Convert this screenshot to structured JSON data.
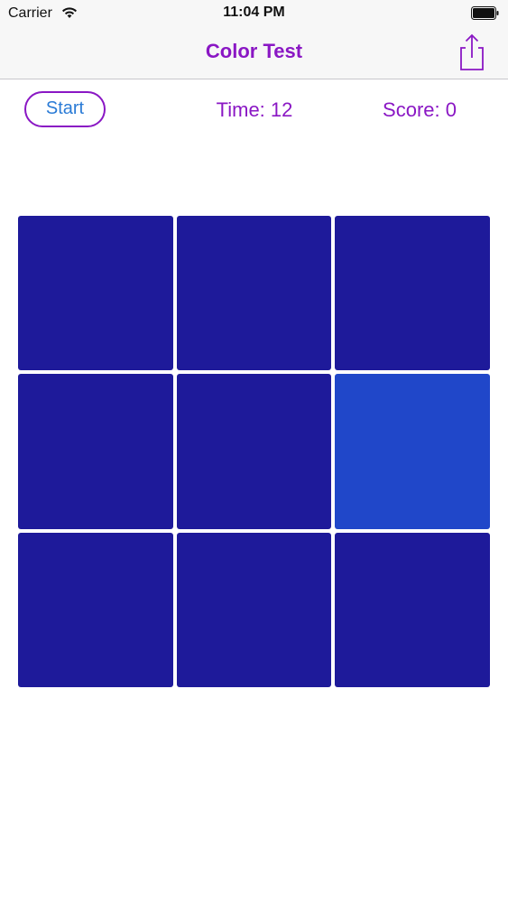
{
  "status_bar": {
    "carrier": "Carrier",
    "time": "11:04 PM",
    "wifi_icon": "wifi-icon",
    "battery_icon": "battery-icon"
  },
  "nav": {
    "title": "Color Test",
    "share_icon": "share-icon"
  },
  "controls": {
    "start_label": "Start",
    "time_text": "Time: 12",
    "score_text": "Score: 0"
  },
  "colors": {
    "accent": "#8a17c4",
    "start_text": "#2a7bd6",
    "tile_base": "#1e1a9a",
    "tile_odd": "#2047c9"
  },
  "grid": {
    "rows": 3,
    "cols": 3,
    "odd_tile_index": 5
  }
}
